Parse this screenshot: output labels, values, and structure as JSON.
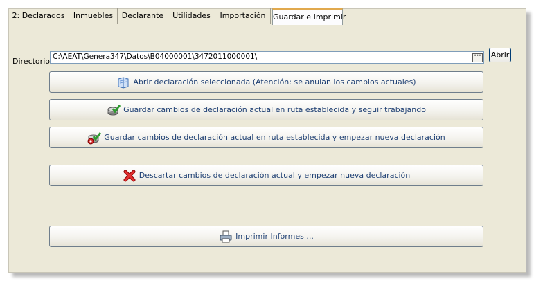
{
  "tabs": [
    {
      "label": "2: Declarados",
      "active": false
    },
    {
      "label": "Inmuebles",
      "active": false
    },
    {
      "label": "Declarante",
      "active": false
    },
    {
      "label": "Utilidades",
      "active": false
    },
    {
      "label": "Importación",
      "active": false
    },
    {
      "label": "Guardar e Imprimir",
      "active": true
    }
  ],
  "directory": {
    "label": "Directorio:",
    "value": "C:\\AEAT\\Genera347\\Datos\\B04000001\\3472011000001\\",
    "browse_icon": "ellipsis-icon",
    "open_button": "Abrir"
  },
  "actions": [
    {
      "label": "Abrir declaración seleccionada (Atención: se anulan los cambios actuales)",
      "icon": "open-file-icon"
    },
    {
      "label": "Guardar cambios de declaración actual en ruta establecida y seguir trabajando",
      "icon": "save-check-icon"
    },
    {
      "label": "Guardar cambios de declaración actual en ruta establecida y empezar nueva declaración",
      "icon": "save-new-icon"
    },
    {
      "label": "Descartar cambios de declaración actual y empezar nueva declaración",
      "icon": "red-x-icon"
    },
    {
      "label": "Imprimir Informes ...",
      "icon": "printer-icon"
    }
  ],
  "colors": {
    "panel_bg": "#ece9d8",
    "button_text": "#1e3f73",
    "active_tab_accent": "#e1a94d"
  }
}
